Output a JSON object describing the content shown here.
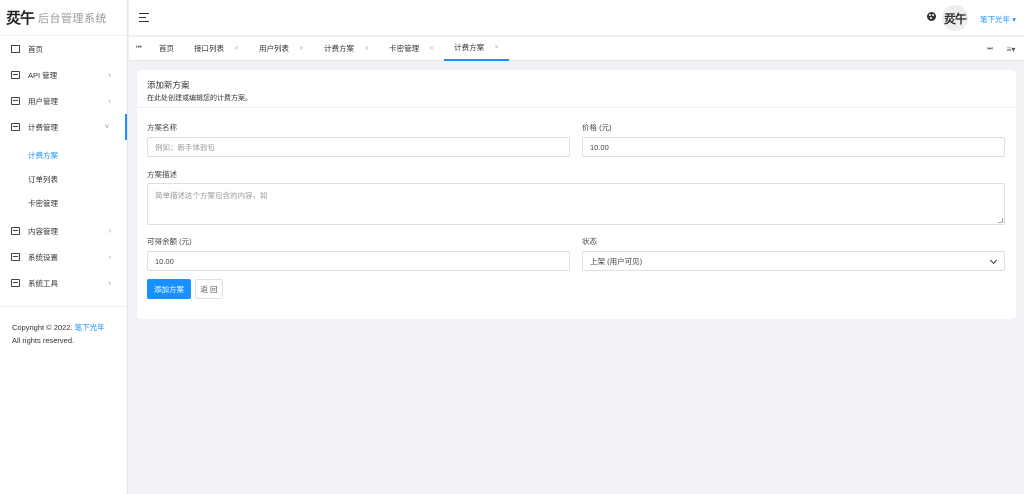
{
  "brand": {
    "logo_mark": "烎午",
    "title": "后台管理系统"
  },
  "sidebar": {
    "items": [
      {
        "label": "首页"
      },
      {
        "label": "API 管理",
        "chevron": "›"
      },
      {
        "label": "用户管理",
        "chevron": "›"
      },
      {
        "label": "计费管理",
        "chevron": "˅",
        "children": [
          {
            "label": "计费方案",
            "active": true
          },
          {
            "label": "订单列表"
          },
          {
            "label": "卡密管理"
          }
        ]
      },
      {
        "label": "内容管理",
        "chevron": "›"
      },
      {
        "label": "系统设置",
        "chevron": "›"
      },
      {
        "label": "系统工具",
        "chevron": "›"
      }
    ],
    "copyright_prefix": "Copyright © 2022.",
    "copyright_link": "笔下光年",
    "copyright_suffix": "All rights reserved."
  },
  "header": {
    "avatar_text": "烎午",
    "user_name": "笔下光年",
    "user_caret": "▾"
  },
  "tabs": {
    "nav_left": "⏮",
    "nav_right": "⏭",
    "menu": "≡▾",
    "close": "✕",
    "items": [
      {
        "label": "首页"
      },
      {
        "label": "接口列表"
      },
      {
        "label": "用户列表"
      },
      {
        "label": "计费方案"
      },
      {
        "label": "卡密管理"
      },
      {
        "label": "计费方案",
        "active": true
      }
    ]
  },
  "form": {
    "title": "添加新方案",
    "subtitle": "在此处创建或编辑您的计费方案。",
    "name_label": "方案名称",
    "name_placeholder": "例如：新手体验包",
    "price_label": "价格 (元)",
    "price_value": "10.00",
    "desc_label": "方案描述",
    "desc_placeholder": "简单描述这个方案包含的内容，如",
    "balance_label": "可得余额 (元)",
    "balance_value": "10.00",
    "status_label": "状态",
    "status_value": "上架 (用户可见)",
    "submit_label": "添加方案",
    "back_label": "返 回"
  },
  "colors": {
    "accent": "#1890ff",
    "background": "#f0f2f5"
  }
}
